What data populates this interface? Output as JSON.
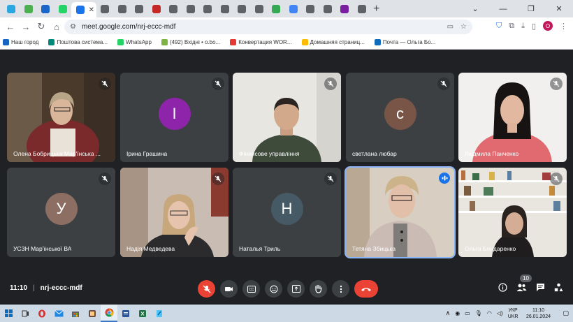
{
  "browser": {
    "tab_colors": [
      "#2aa7e0",
      "#4caf50",
      "#1b66c9",
      "#25d366",
      "#1a73e8",
      "#5f6368",
      "#5f6368",
      "#5f6368",
      "#c62828",
      "#5f6368",
      "#5f6368",
      "#5f6368",
      "#5f6368",
      "#5f6368",
      "#5f6368",
      "#34a853",
      "#4285f4",
      "#5f6368",
      "#5f6368",
      "#7b1fa2",
      "#5f6368"
    ],
    "new_tab_label": "+",
    "url": "meet.google.com/nrj-eccc-mdf",
    "profile_initial": "O",
    "bookmarks": [
      {
        "label": "Наш город",
        "color": "#1565c0"
      },
      {
        "label": "Поштова система...",
        "color": "#00897b"
      },
      {
        "label": "WhatsApp",
        "color": "#25d366"
      },
      {
        "label": "(492) Вхідні • o.bo...",
        "color": "#7cb342"
      },
      {
        "label": "Конвертация WOR...",
        "color": "#e53935"
      },
      {
        "label": "Домашняя страниц...",
        "color": "#fbbc04"
      },
      {
        "label": "Почта — Ольга Бо...",
        "color": "#0f6cbd"
      }
    ]
  },
  "participants": [
    {
      "name": "Олена Бобрицька Мар'їнська ...",
      "type": "video",
      "scene": "elderly-woman"
    },
    {
      "name": "Ірина Грашина",
      "type": "avatar",
      "initial": "I",
      "color": "#8e24aa"
    },
    {
      "name": "Фінансове управління",
      "type": "video",
      "scene": "young-man"
    },
    {
      "name": "светлана любар",
      "type": "avatar",
      "initial": "с",
      "color": "#795548"
    },
    {
      "name": "Людмила Панченко",
      "type": "video",
      "scene": "dark-hair-woman"
    },
    {
      "name": "УСЗН Мар'їнської ВА",
      "type": "avatar",
      "initial": "У",
      "color": "#8d6e63"
    },
    {
      "name": "Надія Медведева",
      "type": "video",
      "scene": "blonde-woman"
    },
    {
      "name": "Наталья Триль",
      "type": "avatar",
      "initial": "Н",
      "color": "#455a64"
    },
    {
      "name": "Тетяна Збицька",
      "type": "video",
      "scene": "speaker-woman",
      "speaking": true
    },
    {
      "name": "Ольга Бондаренко",
      "type": "video",
      "scene": "room-shelves"
    }
  ],
  "controls": {
    "time": "11:10",
    "separator": "|",
    "meeting_code": "nrj-eccc-mdf",
    "participant_count": "10"
  },
  "taskbar": {
    "lang_top": "УКР",
    "lang_bottom": "UKR",
    "time": "11:10",
    "date": "26.01.2024"
  }
}
